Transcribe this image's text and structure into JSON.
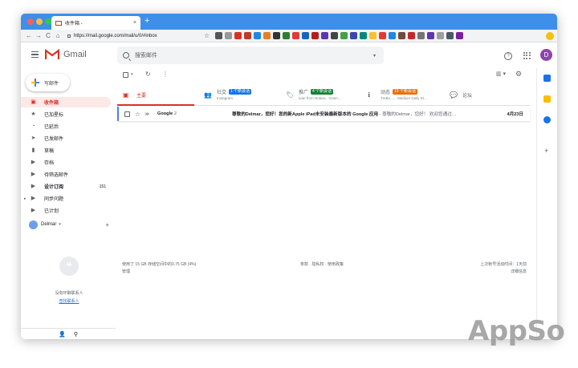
{
  "browser": {
    "tab_title": "收件箱 -",
    "tab_close": "×",
    "new_tab": "+",
    "url": "https://mail.google.com/mail/u/0/#inbox",
    "back": "←",
    "forward": "→",
    "reload": "C",
    "home": "⌂",
    "bookmark_star": "☆"
  },
  "header": {
    "app_name": "Gmail",
    "search_placeholder": "搜索邮件",
    "search_caret": "▾",
    "help": "?",
    "user_initial": "D"
  },
  "sidebar": {
    "compose_label": "写邮件",
    "items": [
      {
        "label": "收件箱",
        "icon": "inbox-icon",
        "glyph": "▣",
        "count": ""
      },
      {
        "label": "已加星标",
        "icon": "star-icon",
        "glyph": "★",
        "count": ""
      },
      {
        "label": "已延后",
        "icon": "clock-icon",
        "glyph": "◔",
        "count": ""
      },
      {
        "label": "已发邮件",
        "icon": "send-icon",
        "glyph": "➤",
        "count": ""
      },
      {
        "label": "草稿",
        "icon": "draft-icon",
        "glyph": "▮",
        "count": ""
      },
      {
        "label": "存档",
        "icon": "label-icon",
        "glyph": "▶",
        "count": ""
      },
      {
        "label": "待筛选邮件",
        "icon": "label-icon",
        "glyph": "▶",
        "count": ""
      },
      {
        "label": "设计订阅",
        "icon": "label-icon",
        "glyph": "▶",
        "count": "151"
      },
      {
        "label": "同步问题",
        "icon": "label-icon",
        "glyph": "▶",
        "count": ""
      },
      {
        "label": "已计划",
        "icon": "label-icon",
        "glyph": "▶",
        "count": ""
      }
    ],
    "expand_arrow": "▸",
    "hangouts_user": "Delmar",
    "hangouts_caret": "▾",
    "hangouts_add": "+",
    "quote_glyph": "❝",
    "no_contacts": "没有环聊联系人",
    "find_contacts": "查找联系人",
    "bottom_person": "👤",
    "bottom_location": "⚲"
  },
  "toolbar": {
    "select_caret": "▾",
    "refresh": "↻",
    "more": "⋮",
    "density": "▥ ▾",
    "settings": "⚙"
  },
  "tabs": [
    {
      "label": "主要",
      "sub": "",
      "badge": "",
      "badge_color": ""
    },
    {
      "label": "社交",
      "sub": "Instagram",
      "badge": "1 个新会话",
      "badge_color": "#1a73e8"
    },
    {
      "label": "推广",
      "sub": "Ivan from Notion、Gram…",
      "badge": "4 个新会话",
      "badge_color": "#188038"
    },
    {
      "label": "动态",
      "sub": "TreBo…、Medium Daily Di…",
      "badge": "19 个新会话",
      "badge_color": "#e8710a"
    },
    {
      "label": "论坛",
      "sub": "",
      "badge": "",
      "badge_color": ""
    }
  ],
  "email": {
    "sender": "Google",
    "thread_count": "2",
    "subject": "尊敬的Delmar，您好！您的新Apple iPad未安装最新版本的 Google 应用",
    "snippet": " - 尊敬的Delmar，您好！ 欢迎您通过…",
    "date": "4月23日",
    "star": "☆",
    "important": "≫"
  },
  "footer": {
    "storage": "使用了 15 GB 存储空间中的0.75 GB (4%)",
    "manage": "管理",
    "terms": "条款 · 隐私权 · 使用政策",
    "last_activity": "上次帐号活动时间：1天前",
    "details": "详细信息"
  },
  "rail": {
    "add": "+"
  },
  "watermark": "AppSo",
  "colors": {
    "accent_red": "#d93025",
    "chrome_blue": "#3f8ee8",
    "avatar": "#8e44ad"
  }
}
